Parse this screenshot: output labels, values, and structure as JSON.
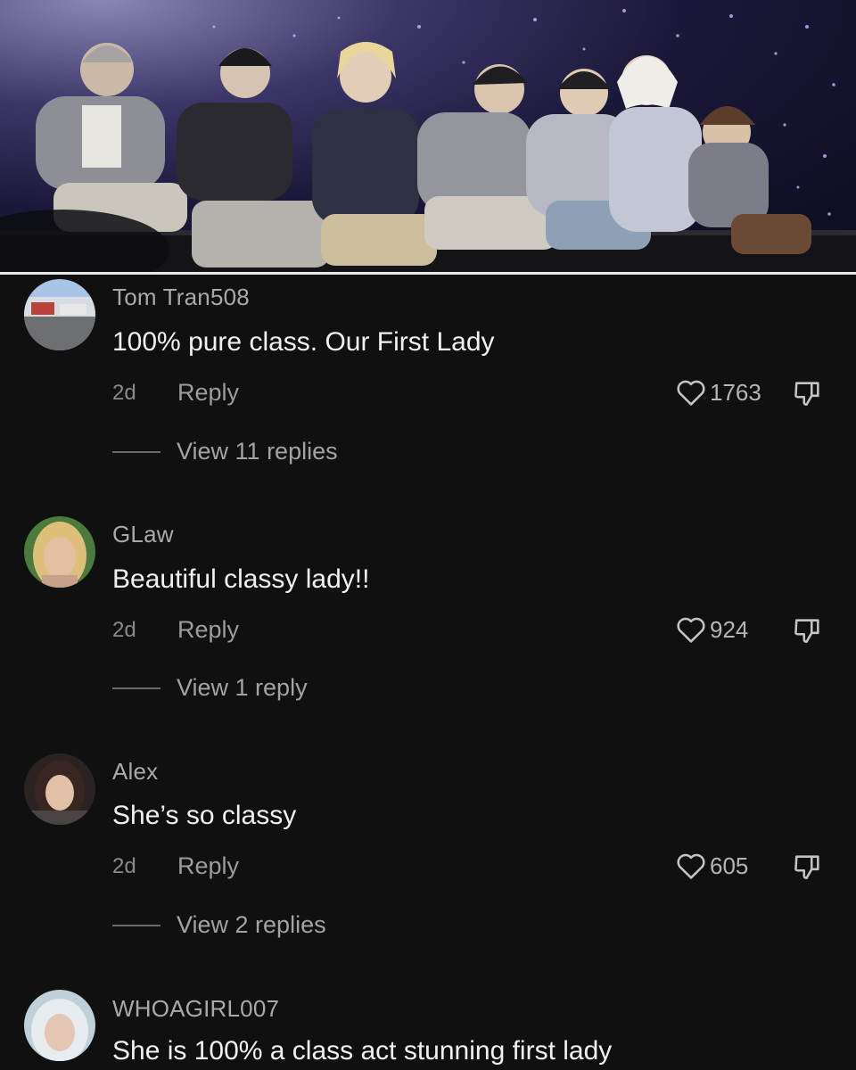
{
  "comments": [
    {
      "username": "Tom Tran508",
      "text": "100% pure class. Our First Lady",
      "time": "2d",
      "reply_label": "Reply",
      "likes": "1763",
      "view_replies": "View 11 replies"
    },
    {
      "username": "GLaw",
      "text": "Beautiful classy lady!!",
      "time": "2d",
      "reply_label": "Reply",
      "likes": "924",
      "view_replies": "View 1 reply"
    },
    {
      "username": "Alex",
      "text": "She’s so classy",
      "time": "2d",
      "reply_label": "Reply",
      "likes": "605",
      "view_replies": "View 2 replies"
    },
    {
      "username": "WHOAGIRL007",
      "text": "She is 100% a class act stunning first lady"
    }
  ],
  "icons": {
    "like": "heart-outline-icon",
    "dislike": "thumbs-down-outline-icon"
  },
  "colors": {
    "background": "#101010",
    "text": "#f1f1f1",
    "muted": "#a3a3a3"
  }
}
